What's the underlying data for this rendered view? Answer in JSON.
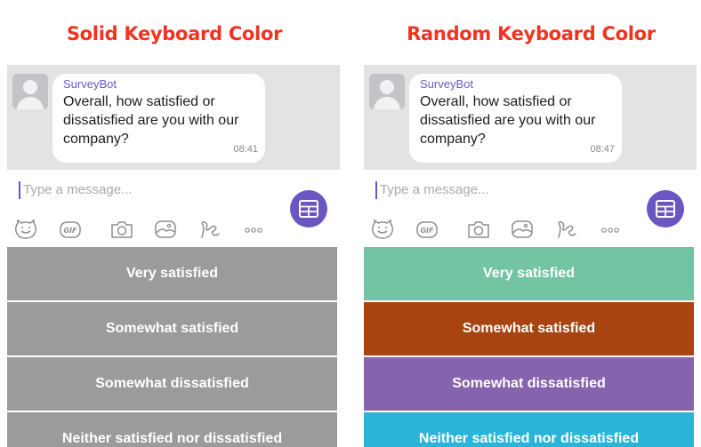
{
  "panels": [
    {
      "heading": "Solid Keyboard Color",
      "sender": "SurveyBot",
      "message": "Overall, how satisfied or dissatisfied are you with our company?",
      "time": "08:41",
      "input_placeholder": "Type a message...",
      "options": [
        {
          "label": "Very satisfied",
          "color": "#9b9b9b"
        },
        {
          "label": "Somewhat satisfied",
          "color": "#9b9b9b"
        },
        {
          "label": "Somewhat dissatisfied",
          "color": "#9b9b9b"
        },
        {
          "label": "Neither satisfied nor dissatisfied",
          "color": "#9b9b9b"
        }
      ]
    },
    {
      "heading": "Random Keyboard Color",
      "sender": "SurveyBot",
      "message": "Overall, how satisfied or dissatisfied are you with our company?",
      "time": "08:47",
      "input_placeholder": "Type a message...",
      "options": [
        {
          "label": "Very satisfied",
          "color": "#73c4a3"
        },
        {
          "label": "Somewhat satisfied",
          "color": "#a84412"
        },
        {
          "label": "Somewhat dissatisfied",
          "color": "#8563ad"
        },
        {
          "label": "Neither satisfied nor dissatisfied",
          "color": "#2ab5d8"
        }
      ]
    }
  ],
  "toolbar_icons": [
    "sticker-icon",
    "gif-icon",
    "camera-icon",
    "gallery-icon",
    "doodle-icon",
    "more-icon"
  ],
  "toolbar_gif_text": "GIF",
  "accent_color": "#6a55c2",
  "heading_color": "#f0341f"
}
